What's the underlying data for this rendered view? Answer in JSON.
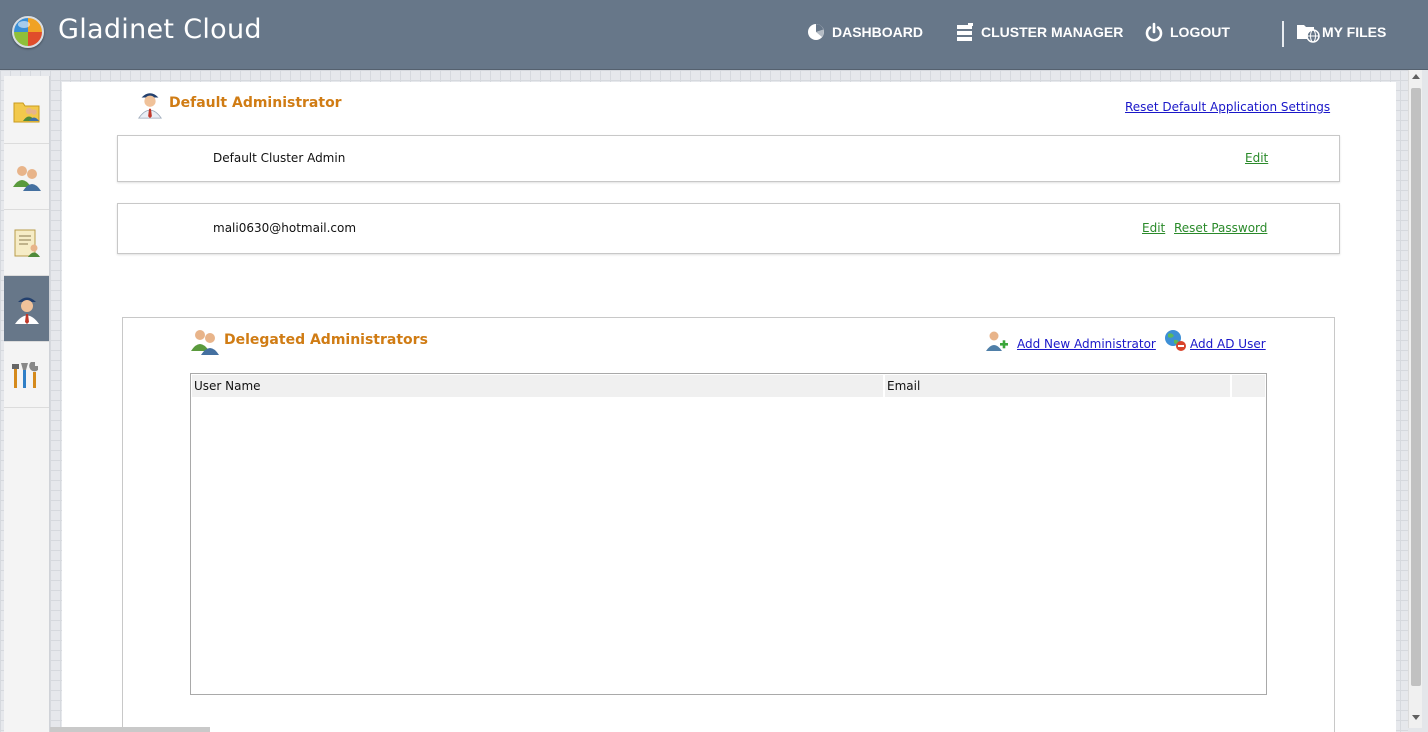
{
  "header": {
    "brand": "Gladinet Cloud",
    "nav": {
      "dashboard": "DASHBOARD",
      "cluster_manager": "CLUSTER MANAGER",
      "logout": "LOGOUT",
      "my_files": "MY FILES"
    },
    "colors": {
      "bar": "#677789",
      "text": "#ffffff"
    }
  },
  "sidebar": {
    "items": [
      {
        "icon": "folder-users-icon",
        "active": false
      },
      {
        "icon": "users-icon",
        "active": false
      },
      {
        "icon": "document-user-icon",
        "active": false
      },
      {
        "icon": "administrator-icon",
        "active": true
      },
      {
        "icon": "tools-icon",
        "active": false
      }
    ]
  },
  "default_admin": {
    "title": "Default Administrator",
    "reset_link": "Reset Default Application Settings",
    "cluster_admin": {
      "label": "Default Cluster Admin",
      "edit": "Edit"
    },
    "account": {
      "email": "mali0630@hotmail.com",
      "edit": "Edit",
      "reset_password": "Reset Password"
    }
  },
  "delegated": {
    "title": "Delegated Administrators",
    "add_new": "Add New Administrator",
    "add_ad": "Add AD User",
    "table": {
      "columns": [
        "User Name",
        "Email",
        ""
      ],
      "rows": []
    }
  },
  "colors": {
    "section_title": "#d07c14",
    "link_blue": "#1a17c9",
    "link_green": "#2a8a2a",
    "sidebar_active": "#677789"
  }
}
